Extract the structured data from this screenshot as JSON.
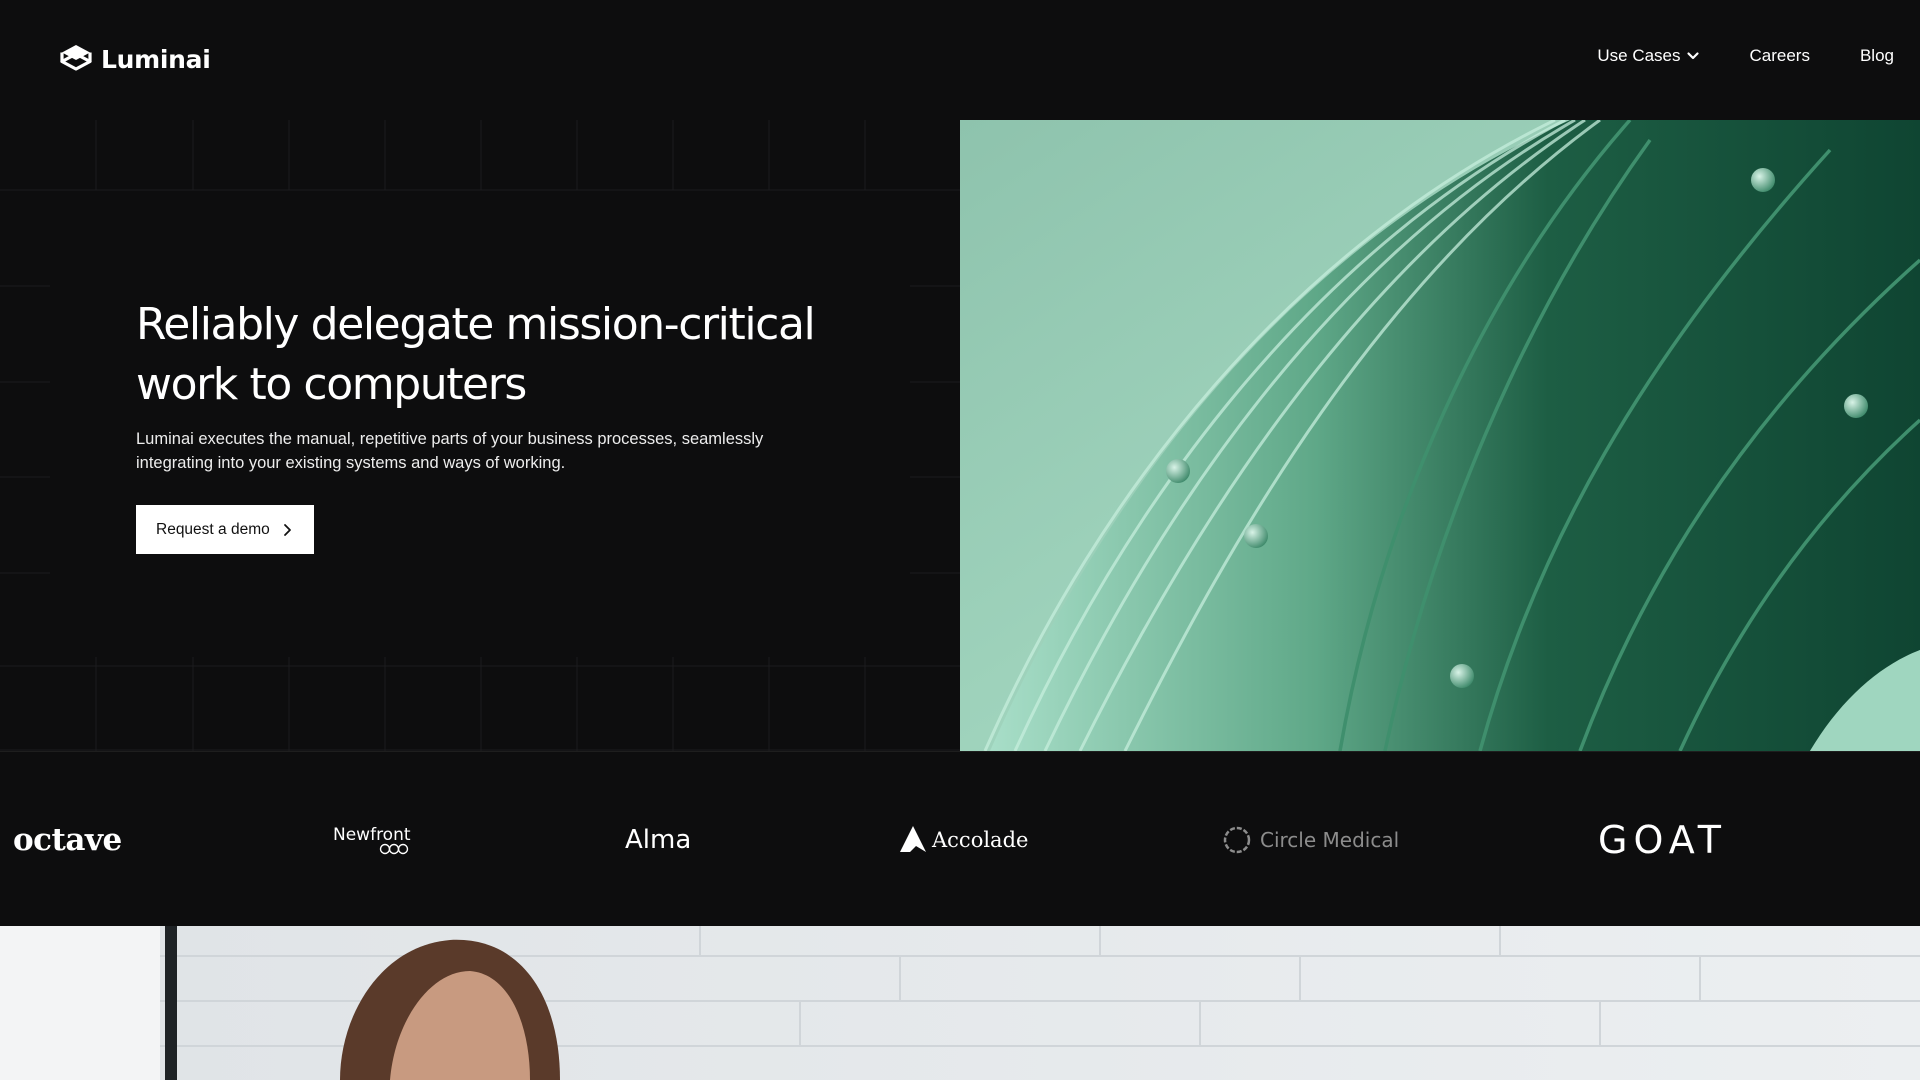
{
  "brand": {
    "name": "Luminai"
  },
  "nav": {
    "items": [
      {
        "label": "Use Cases",
        "has_dropdown": true
      },
      {
        "label": "Careers"
      },
      {
        "label": "Blog"
      }
    ]
  },
  "hero": {
    "title_line1": "Reliably delegate mission-critical",
    "title_line2": "work to computers",
    "subtitle_line1": "Luminai executes the manual, repetitive parts of your business processes, seamlessly",
    "subtitle_line2": "integrating into your existing systems and ways of working.",
    "cta_label": "Request a demo"
  },
  "customers": {
    "logos": [
      {
        "name": "octave"
      },
      {
        "name": "Newfront"
      },
      {
        "name": "Alma"
      },
      {
        "name": "Accolade"
      },
      {
        "name": "Circle Medical"
      },
      {
        "name": "GOAT"
      }
    ]
  },
  "colors": {
    "background": "#0d0d0e",
    "hero_art_light": "#a6dcc6",
    "hero_art_dark": "#0f4a34",
    "cta_background": "#ffffff"
  }
}
